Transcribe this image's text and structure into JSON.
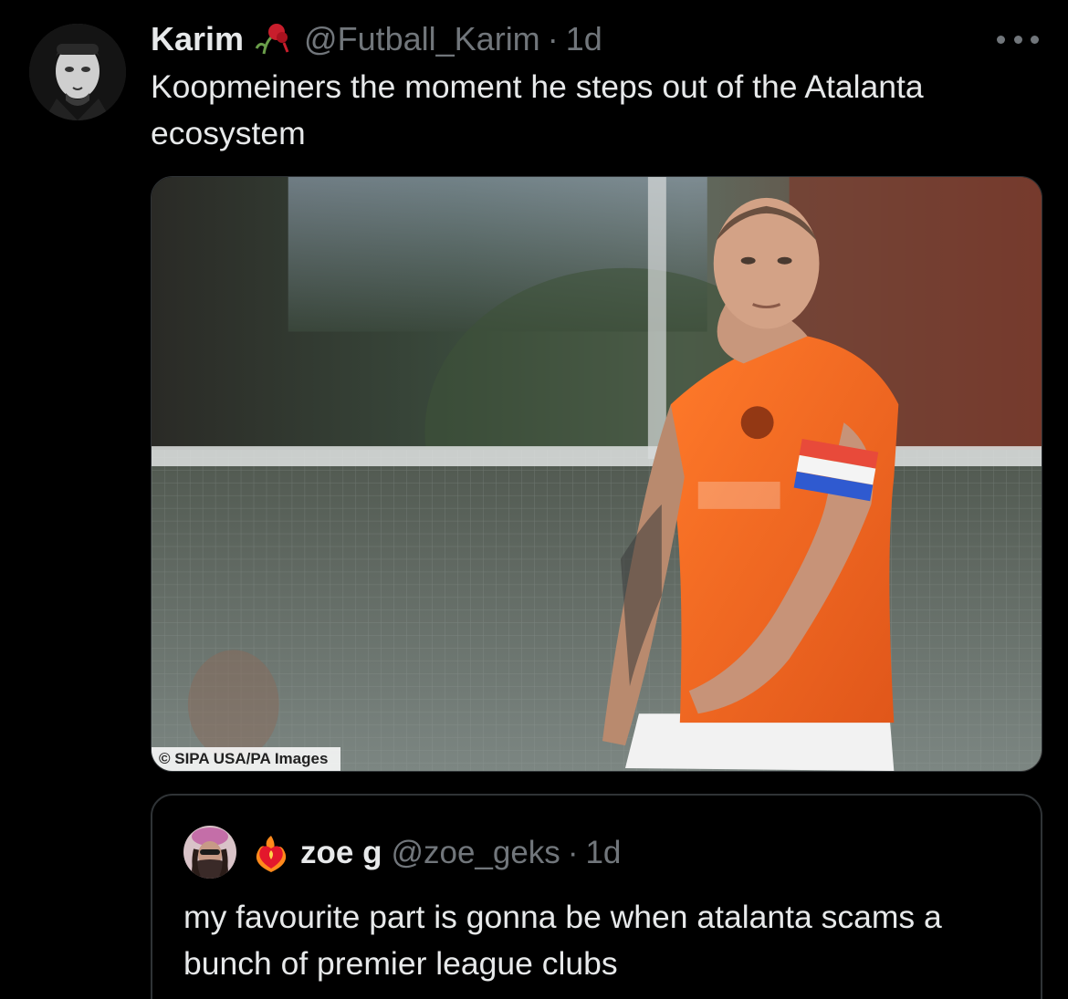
{
  "tweet": {
    "display_name": "Karim",
    "handle": "@Futball_Karim",
    "separator": "·",
    "time": "1d",
    "badge_icon": "rose-emoji-icon",
    "text": "Koopmeiners the moment he steps out of the Atalanta ecosystem",
    "media": {
      "credit": "© SIPA USA/PA Images",
      "description_icon": "footballer-photo"
    }
  },
  "quote": {
    "display_name": "zoe g",
    "handle": "@zoe_geks",
    "separator": "·",
    "time": "1d",
    "badge_icon": "heart-on-fire-icon",
    "text": "my favourite part is gonna be when atalanta scams a bunch of premier league clubs"
  },
  "colors": {
    "background": "#000000",
    "text_primary": "#e7e9ea",
    "text_secondary": "#71767b",
    "border": "#2f3336",
    "jersey_orange": "#f06a1c"
  }
}
